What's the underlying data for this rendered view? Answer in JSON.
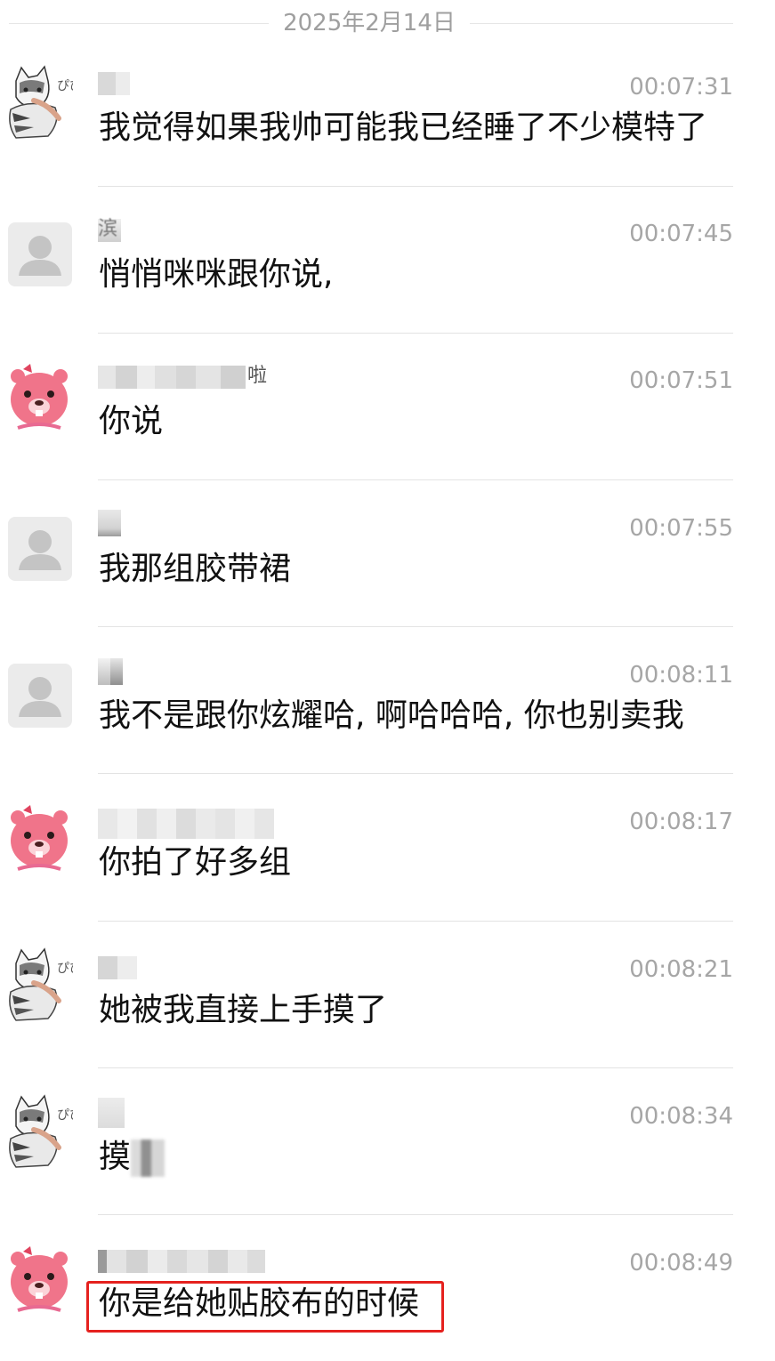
{
  "date_separator": "2025年2月14日",
  "messages": [
    {
      "avatar": "cat-sticker-avatar",
      "sender_suffix": "",
      "time": "00:07:31",
      "text": "我觉得如果我帅可能我已经睡了不少模特了"
    },
    {
      "avatar": "default-person-avatar",
      "sender_suffix": "滨",
      "time": "00:07:45",
      "text": "悄悄咪咪跟你说,"
    },
    {
      "avatar": "pink-beaver-avatar",
      "sender_suffix": "啦",
      "time": "00:07:51",
      "text": "你说"
    },
    {
      "avatar": "default-person-avatar",
      "sender_suffix": "",
      "time": "00:07:55",
      "text": "我那组胶带裙"
    },
    {
      "avatar": "default-person-avatar",
      "sender_suffix": "",
      "time": "00:08:11",
      "text": "我不是跟你炫耀哈, 啊哈哈哈, 你也别卖我"
    },
    {
      "avatar": "pink-beaver-avatar",
      "sender_suffix": "",
      "time": "00:08:17",
      "text": "你拍了好多组"
    },
    {
      "avatar": "cat-sticker-avatar",
      "sender_suffix": "",
      "time": "00:08:21",
      "text": "她被我直接上手摸了"
    },
    {
      "avatar": "cat-sticker-avatar",
      "sender_suffix": "",
      "time": "00:08:34",
      "text": "摸"
    },
    {
      "avatar": "pink-beaver-avatar",
      "sender_suffix": "",
      "time": "00:08:49",
      "text": "你是给她贴胶布的时候"
    }
  ],
  "colors": {
    "highlight_border": "#e5211e",
    "time_text": "#a6a6a6",
    "message_text": "#111111",
    "divider": "#e3e3e3"
  }
}
